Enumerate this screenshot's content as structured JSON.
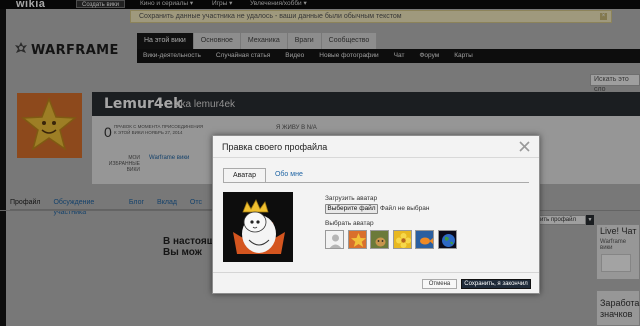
{
  "topbar": {
    "logo": "wikia",
    "create_wiki": "Создать вики",
    "nav": [
      "Кино и сериалы ▾",
      "Игры ▾",
      "Увлечения/хобби ▾"
    ]
  },
  "notice": {
    "text": "Сохранить данные участника не удалось - ваши данные были обычным текстом"
  },
  "brand": {
    "name": "WARFRAME"
  },
  "wiki_nav": {
    "tabs": [
      "На этой вики",
      "Основное",
      "Механика",
      "Враги",
      "Сообщество"
    ],
    "sub": [
      "Вики-деятельность",
      "Случайная статья",
      "Видео",
      "Новые фотографии",
      "Чат",
      "Форум",
      "Карты"
    ]
  },
  "search": {
    "placeholder": "Искать это сло"
  },
  "masthead": {
    "name": "Lemur4ek",
    "aka": "aka lemur4ek",
    "edits_count": "0",
    "edits_label": "ПРАВОК С МОМЕНТА ПРИСОЕДИНЕНИЯ К ЭТОЙ ВИКИ НОЯБРЬ 27, 2014",
    "lives_in": "Я ЖИВУ В N/A",
    "fav_label": "МОИ ИЗБРАННЫЕ ВИКИ",
    "fav_link": "Warframe вики"
  },
  "profile_tabs": [
    "Профайл",
    "Обсуждение участника",
    "Блог",
    "Вклад",
    "Отс"
  ],
  "main_text": [
    "В настоящ",
    "Вы мож"
  ],
  "edit_profile_btn": "ить профайл",
  "rail": {
    "live_title": "Live! Чат",
    "live_sub": "Warframe вики",
    "earn_title": "Заработа",
    "earn_sub": "значков"
  },
  "modal": {
    "title": "Правка своего профайла",
    "tabs": [
      "Аватар",
      "Обо мне"
    ],
    "upload_label": "Загрузить аватар",
    "file_button": "Выберите файл",
    "file_status": "Файл не выбран",
    "choose_label": "Выбрать аватар",
    "cancel": "Отмена",
    "save": "Сохранить, я закончил"
  },
  "colors": {
    "save_button": "#1f2b3a",
    "link": "#2166a5",
    "notice_bg": "#f5ecc0",
    "nav_dark": "#141414"
  }
}
